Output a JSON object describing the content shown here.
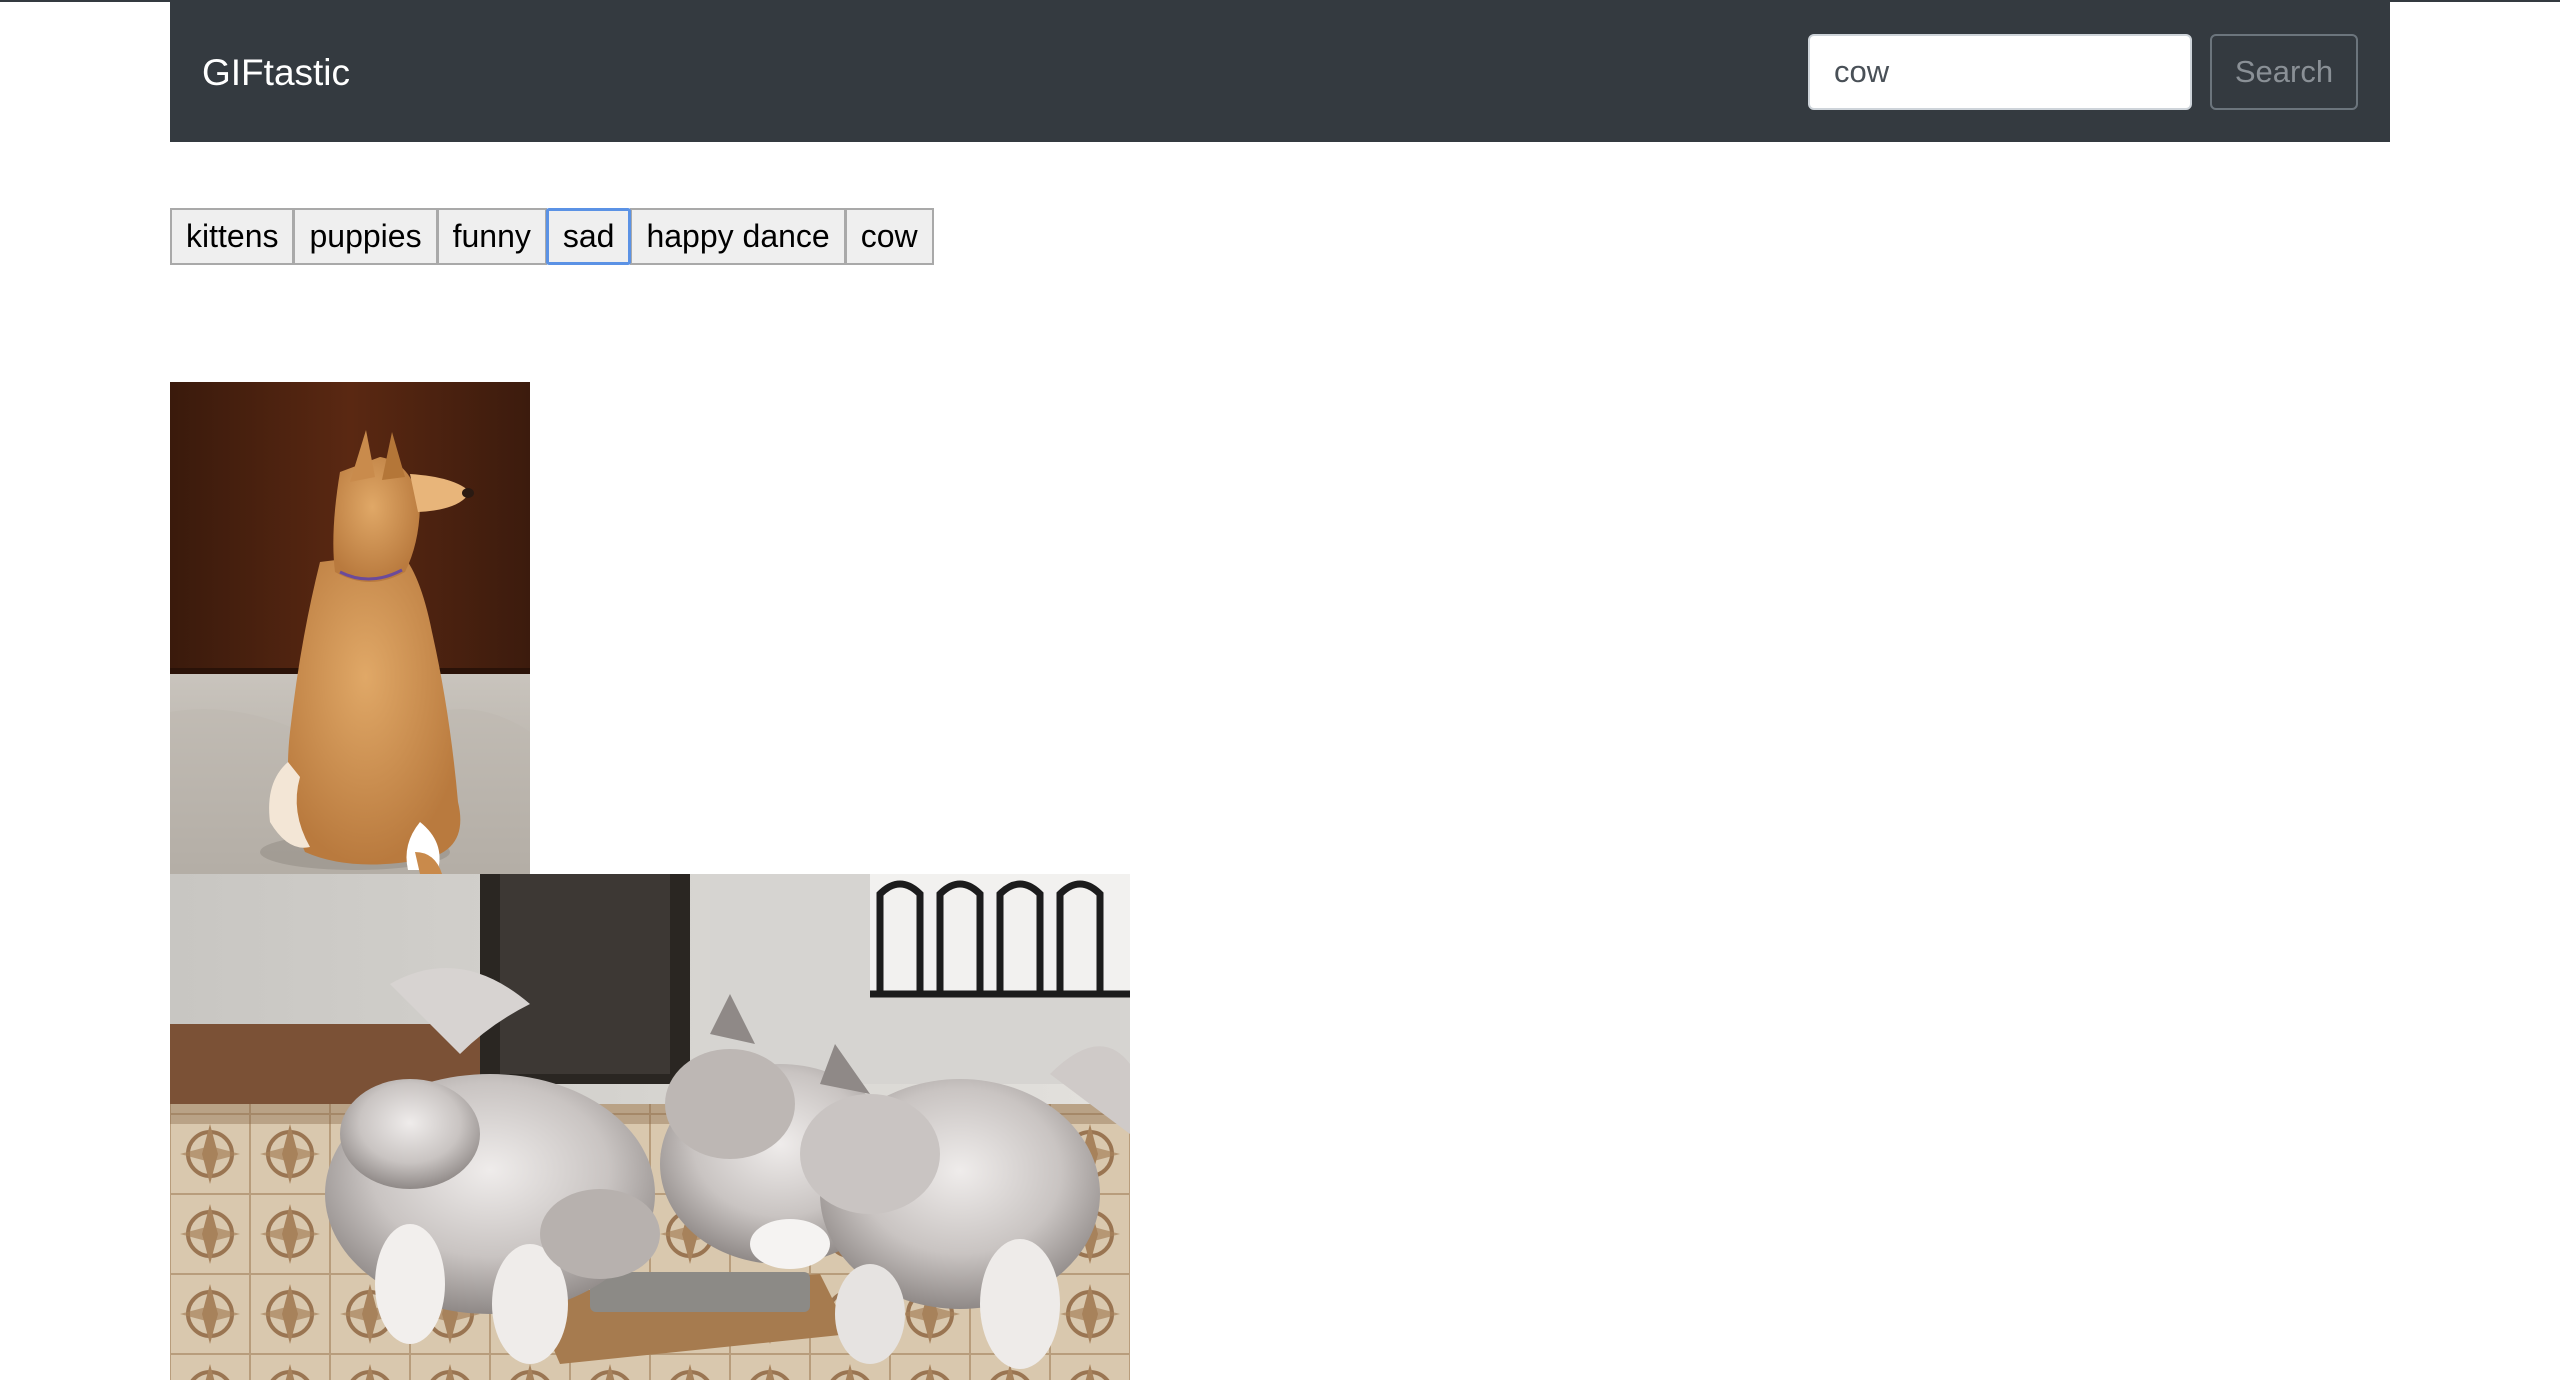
{
  "navbar": {
    "brand": "GIFtastic",
    "search_value": "cow",
    "search_button": "Search"
  },
  "topics": [
    {
      "label": "kittens"
    },
    {
      "label": "puppies"
    },
    {
      "label": "funny"
    },
    {
      "label": "sad",
      "focused": true
    },
    {
      "label": "happy dance"
    },
    {
      "label": "cow"
    }
  ],
  "gifs": [
    {
      "subject": "shiba-inu-puppy-sitting"
    },
    {
      "subject": "husky-puppies-eating"
    }
  ],
  "colors": {
    "navbar": "#343a40",
    "focus_ring": "#5b92e5",
    "button_bg": "#efefef"
  }
}
